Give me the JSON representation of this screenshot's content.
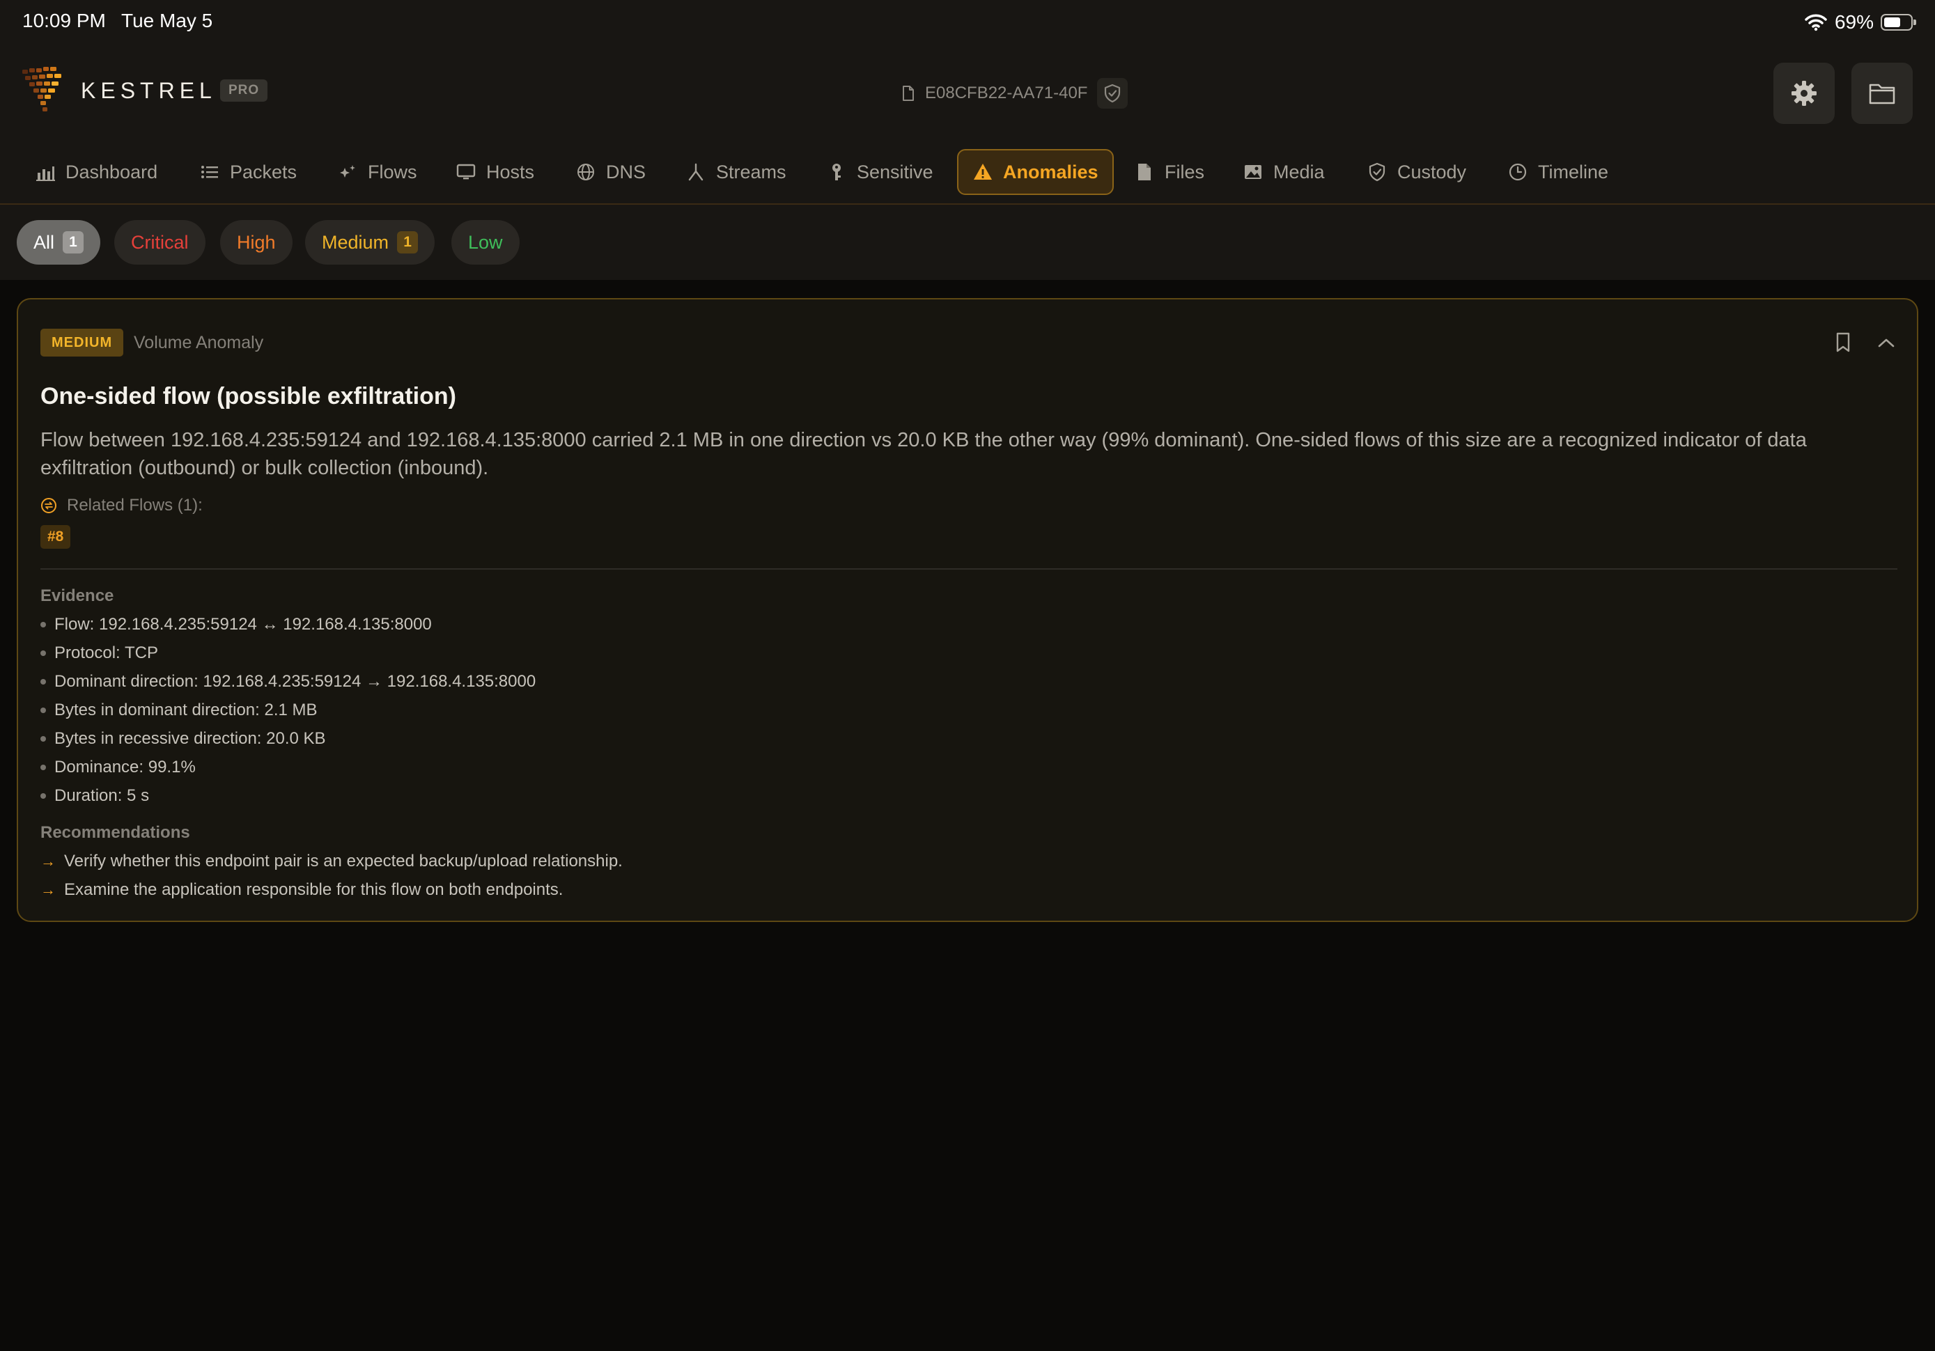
{
  "status_bar": {
    "time": "10:09 PM",
    "date": "Tue May 5",
    "battery_pct_label": "69%",
    "battery_level": 0.69
  },
  "header": {
    "brand": "KESTREL",
    "badge": "PRO",
    "capture_id": "E08CFB22-AA71-40F"
  },
  "tabs": [
    {
      "label": "Dashboard",
      "icon": "bar-chart-icon"
    },
    {
      "label": "Packets",
      "icon": "list-icon"
    },
    {
      "label": "Flows",
      "icon": "sparkle-icon"
    },
    {
      "label": "Hosts",
      "icon": "monitor-icon"
    },
    {
      "label": "DNS",
      "icon": "globe-icon"
    },
    {
      "label": "Streams",
      "icon": "branch-icon"
    },
    {
      "label": "Sensitive",
      "icon": "key-icon"
    },
    {
      "label": "Anomalies",
      "icon": "warning-icon",
      "active": true
    },
    {
      "label": "Files",
      "icon": "file-icon"
    },
    {
      "label": "Media",
      "icon": "image-icon"
    },
    {
      "label": "Custody",
      "icon": "shield-icon"
    },
    {
      "label": "Timeline",
      "icon": "clock-icon"
    }
  ],
  "filters": {
    "all": {
      "label": "All",
      "count": "1"
    },
    "critical": {
      "label": "Critical"
    },
    "high": {
      "label": "High"
    },
    "medium": {
      "label": "Medium",
      "count": "1"
    },
    "low": {
      "label": "Low"
    }
  },
  "anomaly": {
    "severity": "MEDIUM",
    "category": "Volume Anomaly",
    "title": "One-sided flow (possible exfiltration)",
    "description": "Flow between 192.168.4.235:59124 and 192.168.4.135:8000 carried 2.1 MB in one direction vs 20.0 KB the other way (99% dominant). One-sided flows of this size are a recognized indicator of data exfiltration (outbound) or bulk collection (inbound).",
    "related_flows_label": "Related Flows (1):",
    "related_flow_tag": "#8",
    "evidence_label": "Evidence",
    "evidence": [
      "Flow: 192.168.4.235:59124 ↔ 192.168.4.135:8000",
      "Protocol: TCP",
      "Dominant direction: 192.168.4.235:59124 → 192.168.4.135:8000",
      "Bytes in dominant direction: 2.1 MB",
      "Bytes in recessive direction: 20.0 KB",
      "Dominance: 99.1%",
      "Duration: 5 s"
    ],
    "recommendations_label": "Recommendations",
    "recommendations": [
      "Verify whether this endpoint pair is an expected backup/upload relationship.",
      "Examine the application responsible for this flow on both endpoints."
    ]
  },
  "colors": {
    "accent": "#f5a623",
    "medium": "#f0b429",
    "critical": "#e5403a",
    "high": "#f07b2a",
    "low": "#3fbe5a"
  }
}
